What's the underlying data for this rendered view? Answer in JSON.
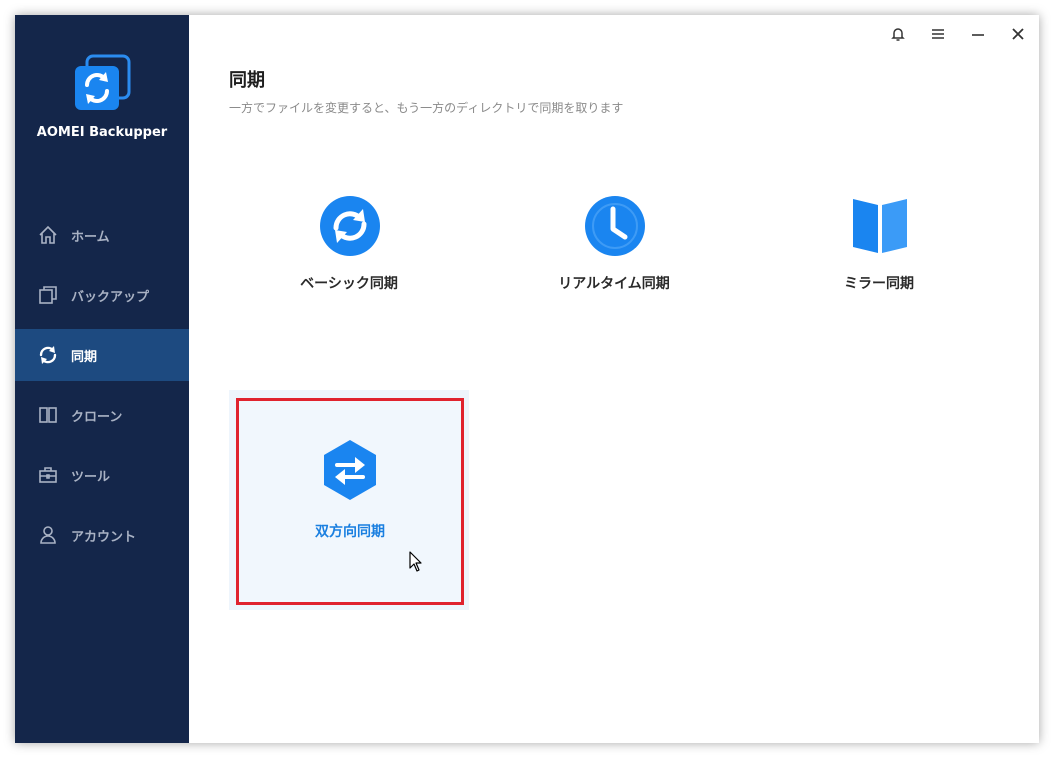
{
  "app": {
    "name": "AOMEI Backupper",
    "logo_icon": "sync-logo-icon"
  },
  "sidebar": {
    "items": [
      {
        "label": "ホーム",
        "icon": "home-icon",
        "active": false
      },
      {
        "label": "バックアップ",
        "icon": "backup-icon",
        "active": false
      },
      {
        "label": "同期",
        "icon": "sync-icon",
        "active": true
      },
      {
        "label": "クローン",
        "icon": "clone-icon",
        "active": false
      },
      {
        "label": "ツール",
        "icon": "toolbox-icon",
        "active": false
      },
      {
        "label": "アカウント",
        "icon": "user-icon",
        "active": false
      }
    ]
  },
  "titlebar": {
    "buttons": [
      "bell-icon",
      "menu-icon",
      "minimize-icon",
      "close-icon"
    ]
  },
  "page": {
    "title": "同期",
    "subtitle": "一方でファイルを変更すると、もう一方のディレクトリで同期を取ります"
  },
  "options": [
    {
      "label": "ベーシック同期",
      "icon": "basic-sync-icon"
    },
    {
      "label": "リアルタイム同期",
      "icon": "realtime-clock-icon"
    },
    {
      "label": "ミラー同期",
      "icon": "mirror-icon"
    },
    {
      "label": "双方向同期",
      "icon": "two-way-sync-icon",
      "highlighted": true
    }
  ],
  "colors": {
    "sidebar_bg": "#14264a",
    "sidebar_active": "#1d4a80",
    "accent_blue": "#1a7fe0",
    "highlight_border": "#e0232e"
  }
}
